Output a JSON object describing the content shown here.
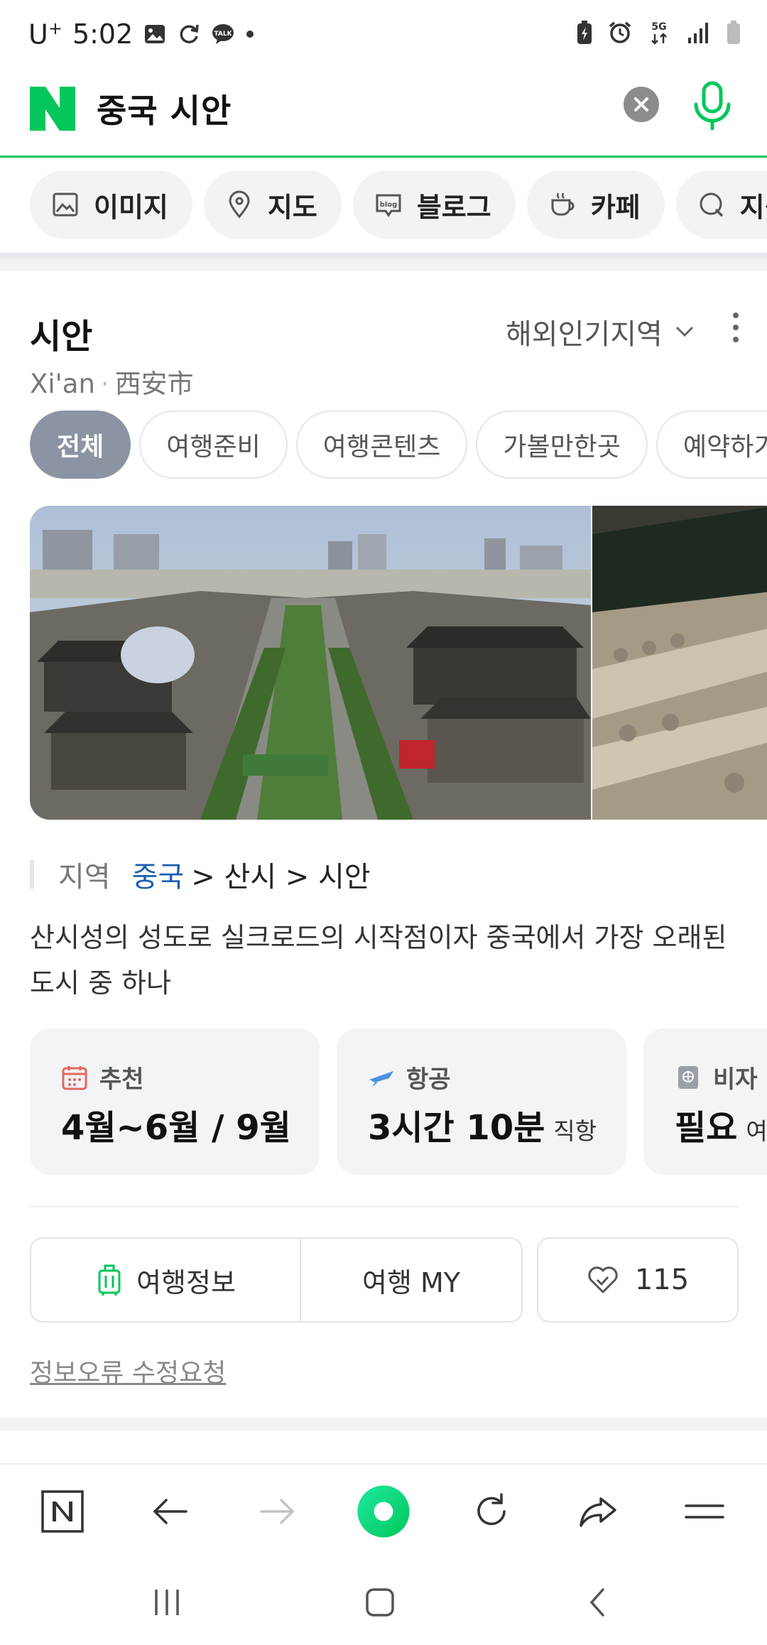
{
  "status_bar": {
    "carrier": "U",
    "carrier_sup": "+",
    "time": "5:02",
    "network": "5G"
  },
  "search": {
    "query": "중국 시안"
  },
  "categories": [
    {
      "label": "이미지",
      "icon": "image-icon"
    },
    {
      "label": "지도",
      "icon": "map-pin-icon"
    },
    {
      "label": "블로그",
      "icon": "blog-icon"
    },
    {
      "label": "카페",
      "icon": "coffee-icon"
    },
    {
      "label": "지식",
      "icon": "q-icon"
    }
  ],
  "place": {
    "title": "시안",
    "region_selector": "해외인기지역",
    "subtitle_en": "Xi'an",
    "subtitle_cn": "西安市",
    "tabs": [
      "전체",
      "여행준비",
      "여행콘텐츠",
      "가볼만한곳",
      "예약하기"
    ],
    "region_label": "지역",
    "region_path_link": "중국",
    "region_path_rest": "> 산시 > 시안",
    "description": "산시성의 성도로 실크로드의 시작점이자 중국에서 가장 오래된 도시 중 하나",
    "info_cards": [
      {
        "caption": "추천",
        "value": "4월~6월 / 9월",
        "sub": "",
        "icon": "calendar-icon"
      },
      {
        "caption": "항공",
        "value": "3시간 10분",
        "sub": "직항",
        "icon": "airplane-icon"
      },
      {
        "caption": "비자",
        "value": "필요",
        "sub": "여",
        "icon": "passport-icon"
      }
    ],
    "actions": {
      "travel_info": "여행정보",
      "travel_my": "여행 MY",
      "like_count": "115"
    },
    "report_link": "정보오류 수정요청"
  },
  "colors": {
    "brand_green": "#03c75a",
    "link_blue": "#1a5fb0",
    "active_tab": "#8a94a3"
  }
}
